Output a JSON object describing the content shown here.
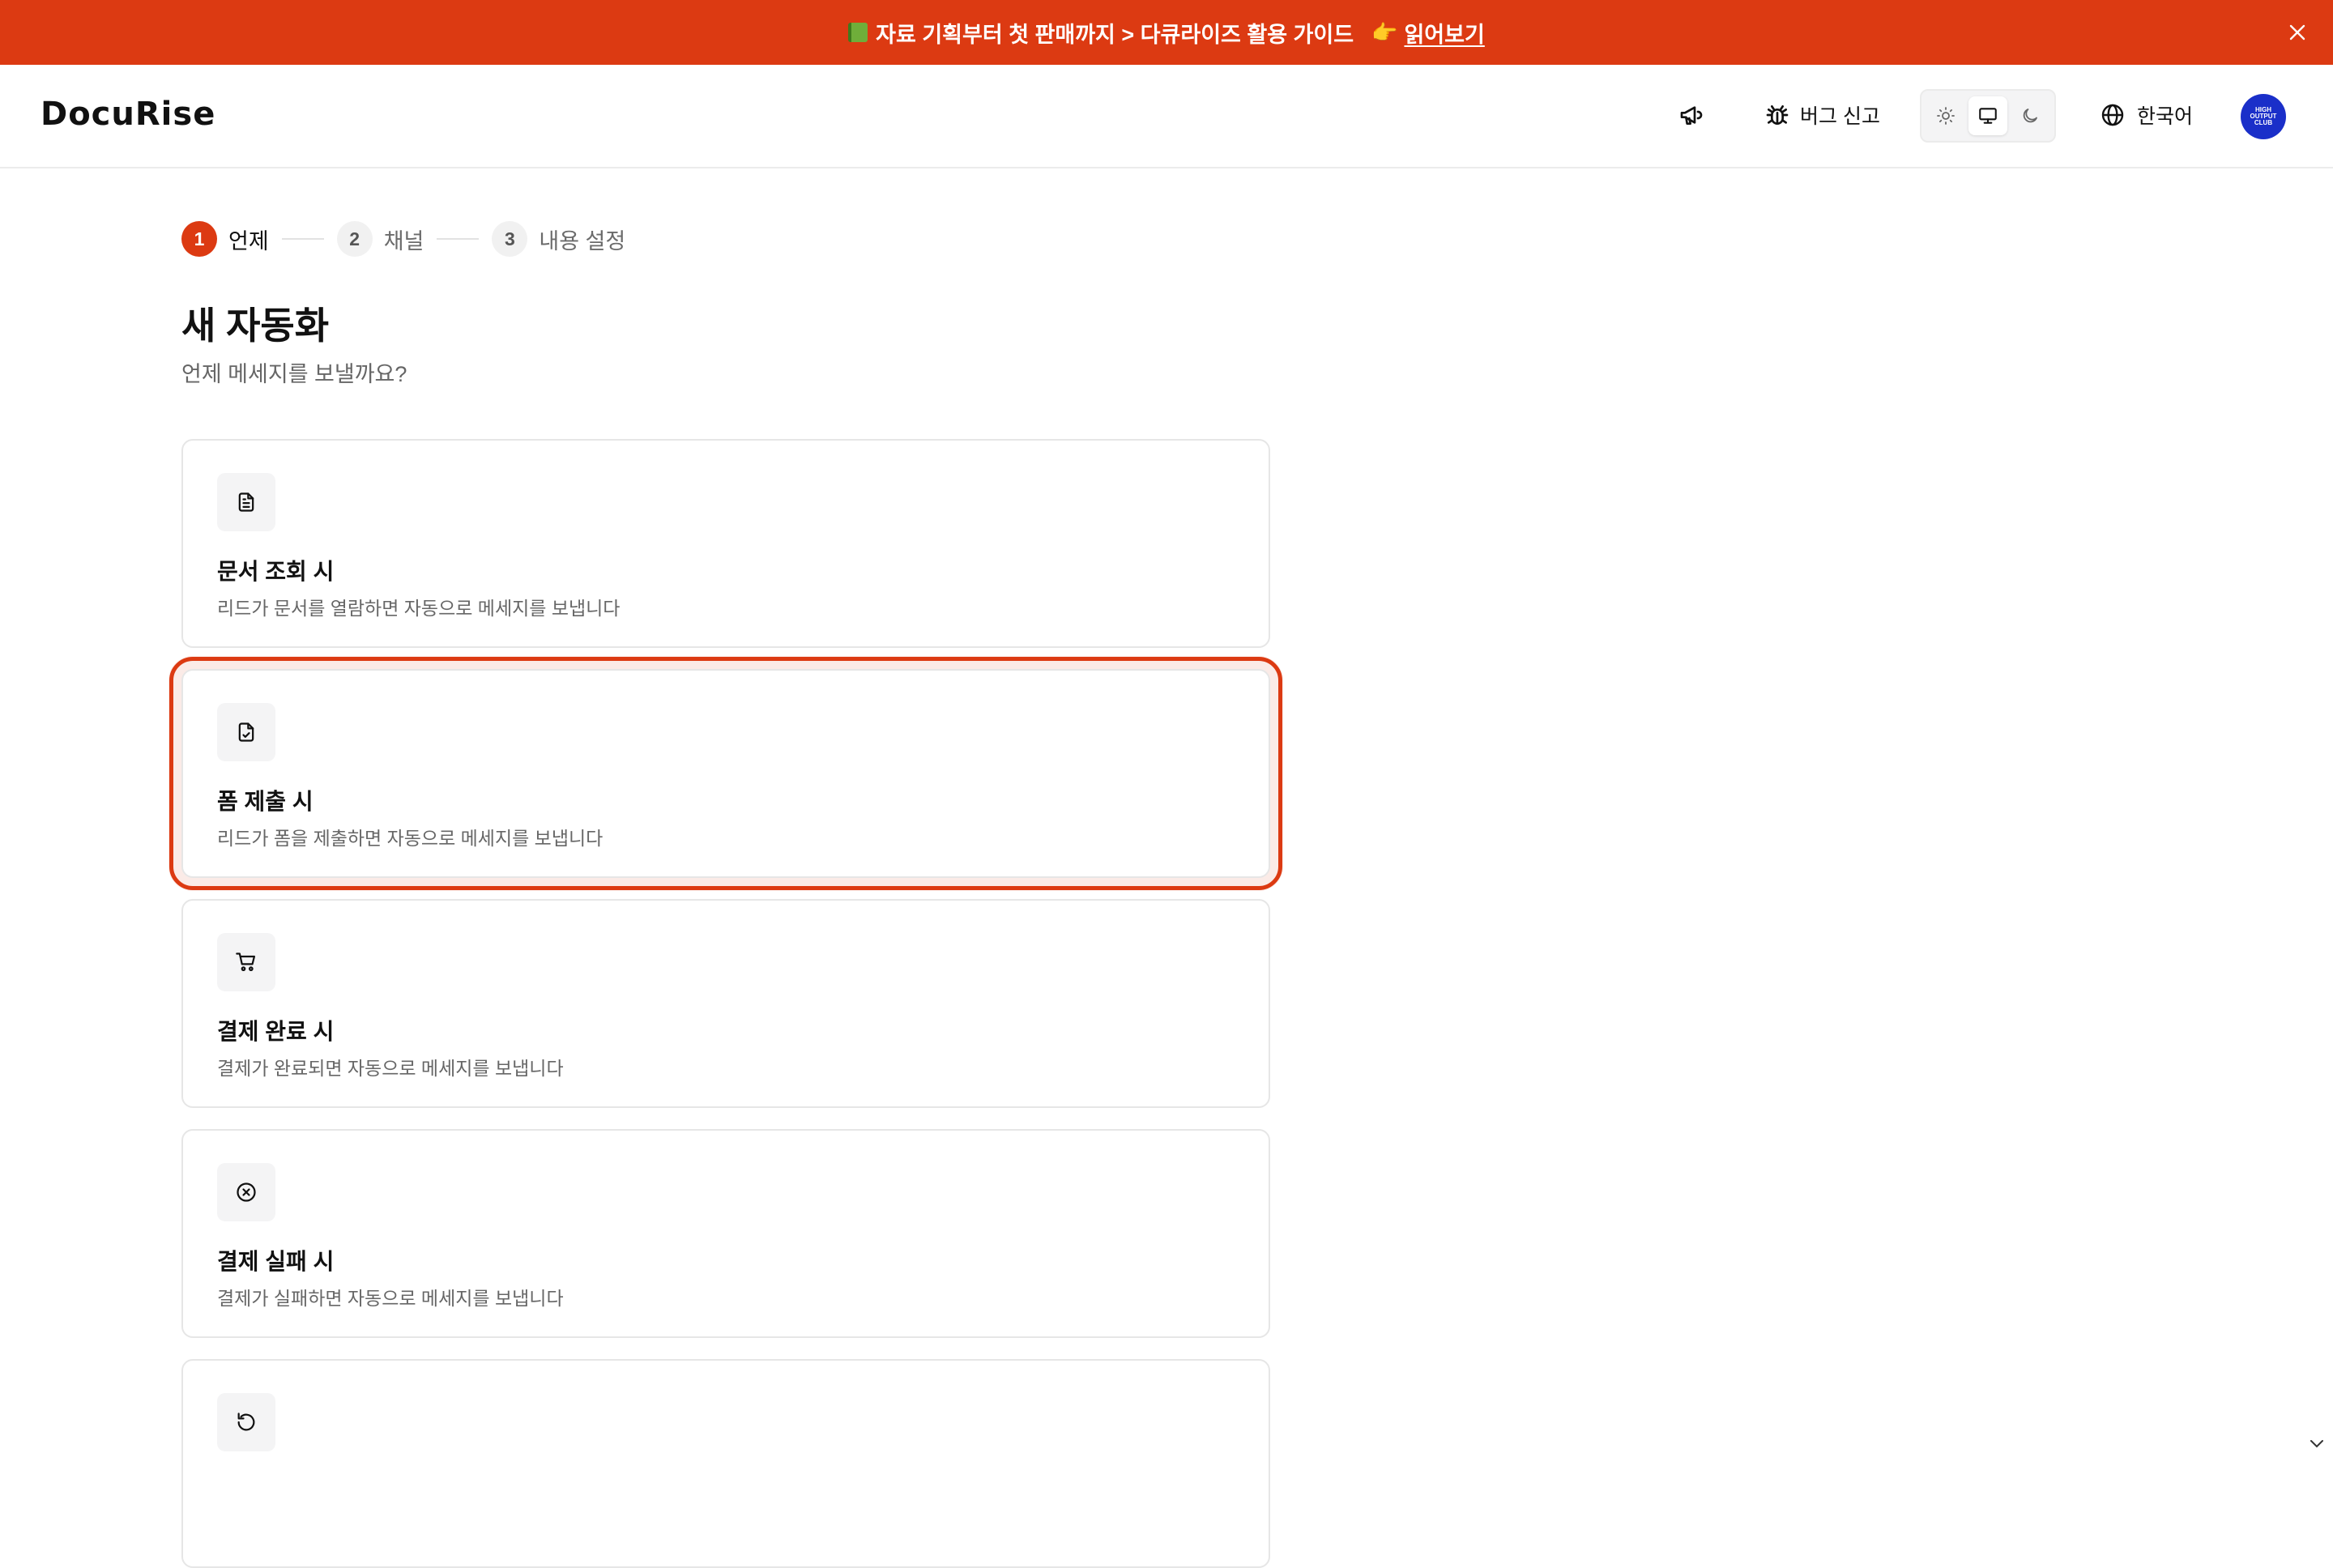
{
  "banner": {
    "text": "자료 기획부터 첫 판매까지 > 다큐라이즈 활용 가이드",
    "link_label": "읽어보기",
    "hand_glyph": "👉",
    "bg_color": "#dc3a12"
  },
  "header": {
    "logo": "DocuRise",
    "bug_report_label": "버그 신고",
    "language_label": "한국어",
    "theme_options": [
      "light",
      "system",
      "dark"
    ],
    "theme_selected": "system",
    "avatar_text": "HIGH OUTPUT CLUB"
  },
  "stepper": {
    "steps": [
      {
        "num": "1",
        "label": "언제",
        "active": true
      },
      {
        "num": "2",
        "label": "채널",
        "active": false
      },
      {
        "num": "3",
        "label": "내용 설정",
        "active": false
      }
    ]
  },
  "page": {
    "title": "새 자동화",
    "subtitle": "언제 메세지를 보낼까요?"
  },
  "triggers": [
    {
      "icon": "document-icon",
      "title": "문서 조회 시",
      "desc": "리드가 문서를 열람하면 자동으로 메세지를 보냅니다",
      "selected": false
    },
    {
      "icon": "form-check-icon",
      "title": "폼 제출 시",
      "desc": "리드가 폼을 제출하면 자동으로 메세지를 보냅니다",
      "selected": true
    },
    {
      "icon": "cart-icon",
      "title": "결제 완료 시",
      "desc": "결제가 완료되면 자동으로 메세지를 보냅니다",
      "selected": false
    },
    {
      "icon": "x-circle-icon",
      "title": "결제 실패 시",
      "desc": "결제가 실패하면 자동으로 메세지를 보냅니다",
      "selected": false
    },
    {
      "icon": "refresh-icon",
      "title": "",
      "desc": "",
      "selected": false
    }
  ],
  "colors": {
    "accent": "#dc3a12",
    "avatar_bg": "#1a2fc9"
  }
}
